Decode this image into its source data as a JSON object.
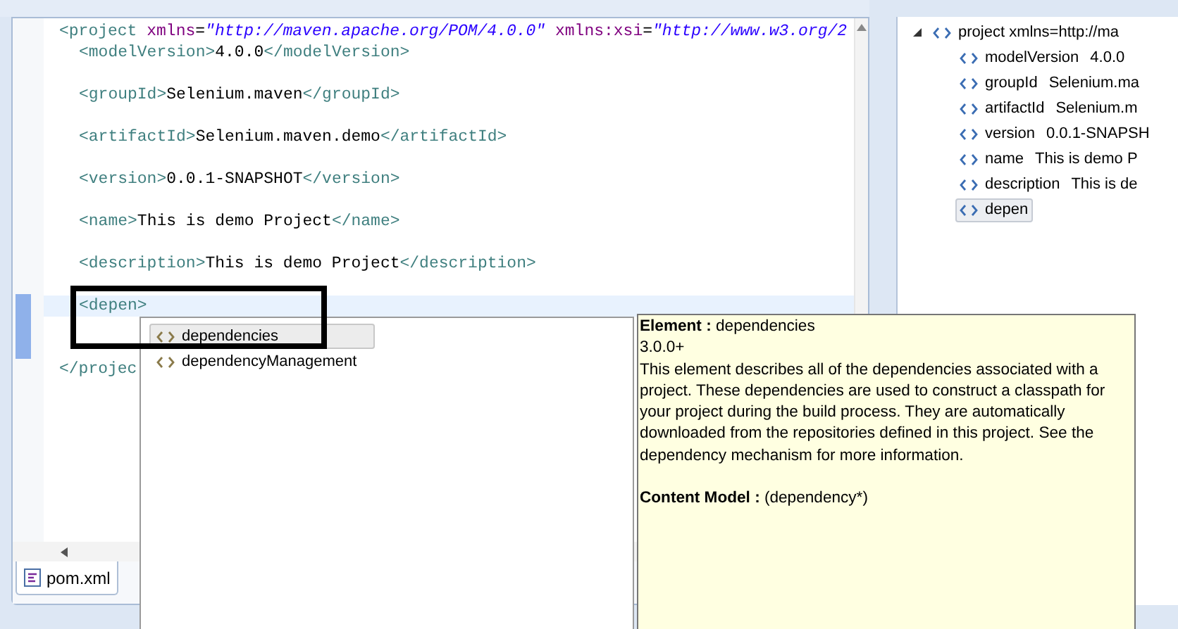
{
  "editor": {
    "lines": [
      {
        "kind": "code",
        "segments": [
          {
            "kind": "tag",
            "text": "<project"
          },
          {
            "kind": "attr",
            "text": " xmlns"
          },
          {
            "kind": "text",
            "text": "="
          },
          {
            "kind": "value",
            "text": "\"http://maven.apache.org/POM/4.0.0\""
          },
          {
            "kind": "attr",
            "text": " xmlns:xsi"
          },
          {
            "kind": "text",
            "text": "="
          },
          {
            "kind": "value",
            "text": "\"http://www.w3.org/2"
          }
        ],
        "children": [
          {
            "kind": "code",
            "segments": [
              {
                "kind": "tag",
                "text": "<modelVersion>"
              },
              {
                "kind": "text",
                "text": "4.0.0"
              },
              {
                "kind": "tag",
                "text": "</modelVersion>"
              }
            ]
          },
          {
            "kind": "blank"
          },
          {
            "kind": "code",
            "segments": [
              {
                "kind": "tag",
                "text": "<groupId>"
              },
              {
                "kind": "text",
                "text": "Selenium.maven"
              },
              {
                "kind": "tag",
                "text": "</groupId>"
              }
            ]
          },
          {
            "kind": "blank"
          },
          {
            "kind": "code",
            "segments": [
              {
                "kind": "tag",
                "text": "<artifactId>"
              },
              {
                "kind": "text",
                "text": "Selenium.maven.demo"
              },
              {
                "kind": "tag",
                "text": "</artifactId>"
              }
            ]
          },
          {
            "kind": "blank"
          },
          {
            "kind": "code",
            "segments": [
              {
                "kind": "tag",
                "text": "<version>"
              },
              {
                "kind": "text",
                "text": "0.0.1-SNAPSHOT"
              },
              {
                "kind": "tag",
                "text": "</version>"
              }
            ]
          },
          {
            "kind": "blank"
          },
          {
            "kind": "code",
            "segments": [
              {
                "kind": "tag",
                "text": "<name>"
              },
              {
                "kind": "text",
                "text": "This is demo Project"
              },
              {
                "kind": "tag",
                "text": "</name>"
              }
            ]
          },
          {
            "kind": "blank"
          },
          {
            "kind": "code",
            "segments": [
              {
                "kind": "tag",
                "text": "<description>"
              },
              {
                "kind": "text",
                "text": "This is demo Project"
              },
              {
                "kind": "tag",
                "text": "</description>"
              }
            ]
          },
          {
            "kind": "blank"
          },
          {
            "kind": "code",
            "current": true,
            "segments": [
              {
                "kind": "tag",
                "text": "<depen>"
              }
            ]
          },
          {
            "kind": "blank"
          },
          {
            "kind": "blank"
          }
        ]
      },
      {
        "kind": "code",
        "segments": [
          {
            "kind": "tag",
            "text": "</projec"
          }
        ]
      }
    ]
  },
  "editor_tab": {
    "label": "pom.xml"
  },
  "outline": {
    "items": [
      {
        "name": "project xmlns=http://ma",
        "expanded": true,
        "selected": false,
        "children": [
          {
            "name": "modelVersion",
            "value": "4.0.0",
            "selected": false
          },
          {
            "name": "groupId",
            "value": "Selenium.ma",
            "selected": false
          },
          {
            "name": "artifactId",
            "value": "Selenium.m",
            "selected": false
          },
          {
            "name": "version",
            "value": "0.0.1-SNAPSH",
            "selected": false
          },
          {
            "name": "name",
            "value": "This is demo P",
            "selected": false
          },
          {
            "name": "description",
            "value": "This is de",
            "selected": false
          },
          {
            "name": "depen",
            "selected": true
          }
        ]
      }
    ]
  },
  "completion": {
    "items": [
      {
        "label": "dependencies",
        "selected": true
      },
      {
        "label": "dependencyManagement",
        "selected": false
      }
    ]
  },
  "info": {
    "element_label": "Element :",
    "element": "dependencies",
    "version": "3.0.0+",
    "description": "This element describes all of the dependencies associated with a project. These dependencies are used to construct a classpath for your project during the build process. They are automatically downloaded from the repositories defined in this project. See the dependency mechanism for more information.",
    "content_model_label": "Content Model :",
    "content_model": "(dependency*)"
  }
}
